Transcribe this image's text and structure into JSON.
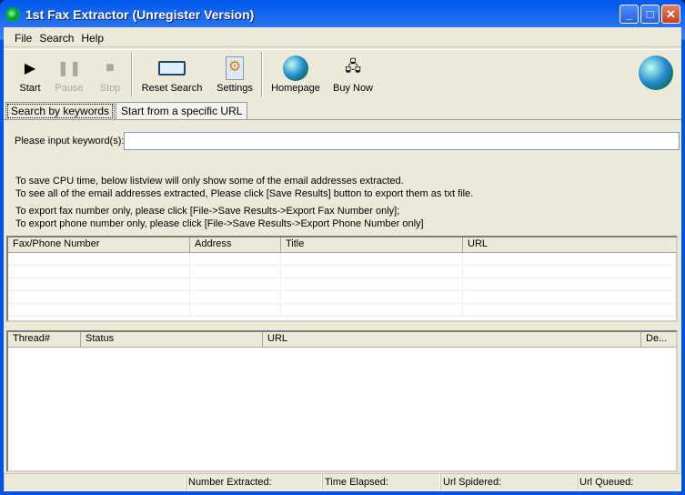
{
  "window": {
    "title": "1st Fax Extractor (Unregister Version)",
    "buttons": [
      "_",
      "□",
      "✕"
    ]
  },
  "menu": [
    "File",
    "Search",
    "Help"
  ],
  "toolbar": {
    "start": "Start",
    "pause": "Pause",
    "stop": "Stop",
    "reset": "Reset Search",
    "settings": "Settings",
    "homepage": "Homepage",
    "buynow": "Buy Now"
  },
  "tabs": [
    "Search by keywords",
    "Start from a specific URL"
  ],
  "search": {
    "label": "Please input keyword(s):",
    "value": ""
  },
  "info": [
    "To save CPU time, below listview will only show some of the email addresses extracted.",
    "To see all of the email addresses extracted, Please click [Save Results] button to export them as txt file.",
    "To export fax number only, please click [File->Save Results->Export Fax Number only];",
    "To export phone number only, please click [File->Save Results->Export Phone Number only]"
  ],
  "results": {
    "columns": [
      "Fax/Phone Number",
      "Address",
      "Title",
      "URL"
    ],
    "rows": []
  },
  "threads": {
    "columns": [
      "Thread#",
      "Status",
      "URL",
      "De..."
    ],
    "rows": []
  },
  "statusbar": [
    "",
    "Number Extracted:",
    "Time Elapsed:",
    "Url Spidered:",
    "Url Queued:"
  ]
}
